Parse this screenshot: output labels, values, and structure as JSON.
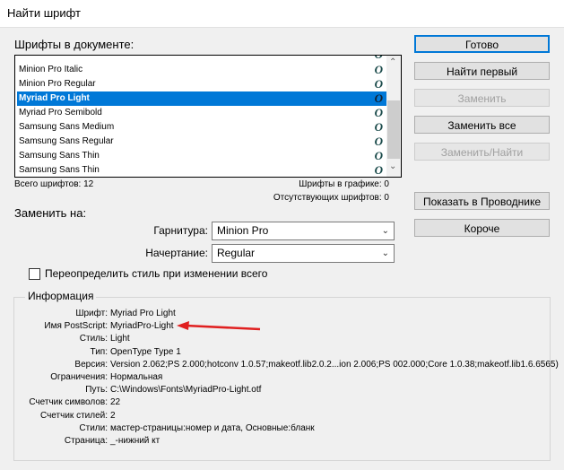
{
  "window": {
    "title": "Найти шрифт"
  },
  "fonts_section": {
    "label": "Шрифты в документе:",
    "items": [
      {
        "name": "Minion Pro Italic"
      },
      {
        "name": "Minion Pro Regular"
      },
      {
        "name": "Myriad Pro Light",
        "selected": true
      },
      {
        "name": "Myriad Pro Semibold"
      },
      {
        "name": "Samsung Sans Medium"
      },
      {
        "name": "Samsung Sans Regular"
      },
      {
        "name": "Samsung Sans Thin"
      },
      {
        "name": "Samsung Sans Thin"
      }
    ],
    "icon": "opentype-font-icon",
    "total": "Всего шрифтов: 12",
    "in_graphics": "Шрифты в графике: 0",
    "missing": "Отсутствующих шрифтов: 0"
  },
  "buttons": {
    "done": "Готово",
    "find_first": "Найти первый",
    "replace": "Заменить",
    "replace_all": "Заменить все",
    "replace_find": "Заменить/Найти",
    "show_explorer": "Показать в Проводнике",
    "shorter": "Короче"
  },
  "replace": {
    "label": "Заменить на:",
    "family_label": "Гарнитура:",
    "family_value": "Minion Pro",
    "style_label": "Начертание:",
    "style_value": "Regular",
    "override_label": "Переопределить стиль при изменении всего",
    "override_checked": false
  },
  "info": {
    "label": "Информация",
    "rows": [
      {
        "k": "Шрифт:",
        "v": "Myriad Pro Light"
      },
      {
        "k": "Имя PostScript:",
        "v": "MyriadPro-Light"
      },
      {
        "k": "Стиль:",
        "v": "Light"
      },
      {
        "k": "Тип:",
        "v": "OpenType Type 1"
      },
      {
        "k": "Версия:",
        "v": "Version 2.062;PS 2.000;hotconv 1.0.57;makeotf.lib2.0.2...ion 2.006;PS 002.000;Core 1.0.38;makeotf.lib1.6.6565)"
      },
      {
        "k": "Ограничения:",
        "v": "Нормальная"
      },
      {
        "k": "Путь:",
        "v": "C:\\Windows\\Fonts\\MyriadPro-Light.otf"
      },
      {
        "k": "Счетчик символов:",
        "v": "22"
      },
      {
        "k": "Счетчик стилей:",
        "v": "2"
      },
      {
        "k": "Стили:",
        "v": "мастер-страницы:номер и дата, Основные:бланк"
      },
      {
        "k": "Страница:",
        "v": "_-нижний кт"
      }
    ]
  },
  "colors": {
    "selection": "#0078d7",
    "arrow": "#e02020"
  }
}
